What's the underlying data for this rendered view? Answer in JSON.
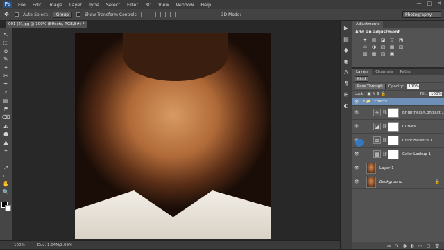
{
  "app": {
    "logo": "Ps"
  },
  "menu": [
    "File",
    "Edit",
    "Image",
    "Layer",
    "Type",
    "Select",
    "Filter",
    "3D",
    "View",
    "Window",
    "Help"
  ],
  "window_controls": [
    "—",
    "□",
    "✕"
  ],
  "options_bar": {
    "auto_select_label": "Auto-Select:",
    "auto_select_value": "Group",
    "transform_label": "Show Transform Controls",
    "mode_3d_label": "3D Mode:",
    "workspace": "Photography"
  },
  "document": {
    "tab_title": "001 (2).jpg @ 100% (Effects, RGB/8#) * ×",
    "zoom": "100%",
    "doc_info": "Doc: 1.04M/2.09M"
  },
  "tools": [
    "↖",
    "⬚",
    "ϕ",
    "✎",
    "⌖",
    "✂",
    "✒",
    "⚕",
    "▤",
    "⚑",
    "⌫",
    "◭",
    "●",
    "▲",
    "✦",
    "T",
    "↗",
    "▭",
    "✋",
    "🔍"
  ],
  "mini_panel_icons": [
    "▶",
    "▤",
    "◆",
    "◉",
    "A",
    "¶",
    "⊞",
    "◐"
  ],
  "right_panels": {
    "adjustments_tabs": [
      "Adjustments"
    ],
    "adjustments_title": "Add an adjustment",
    "adj_icons_row1": [
      "☀",
      "▥",
      "◪",
      "▽",
      "⬔"
    ],
    "adj_icons_row2": [
      "⚖",
      "◑",
      "◰",
      "▦",
      "◫"
    ],
    "adj_icons_row3": [
      "▨",
      "▩",
      "◳",
      "▣"
    ],
    "layers_tabs": [
      "Layers",
      "Channels",
      "Paths"
    ],
    "kind_label": "Kind",
    "blend_mode": "Pass Through",
    "opacity_label": "Opacity:",
    "opacity_value": "100%",
    "lock_label": "Lock:",
    "fill_label": "Fill:",
    "fill_value": "100%",
    "layers": [
      {
        "name": "Effects",
        "icon": "▾ 📁"
      },
      {
        "name": "Brightness/Contrast 1",
        "icon": "☀"
      },
      {
        "name": "Curves 1",
        "icon": "◪"
      },
      {
        "name": "Color Balance 1",
        "icon": "⚖"
      },
      {
        "name": "Color Lookup 1",
        "icon": "▦"
      },
      {
        "name": "Layer 1",
        "icon": ""
      },
      {
        "name": "Background",
        "icon": "🔒"
      }
    ],
    "footer_icons": [
      "⇔",
      "fx",
      "◑",
      "◐",
      "▭",
      "▢",
      "🗑"
    ]
  }
}
